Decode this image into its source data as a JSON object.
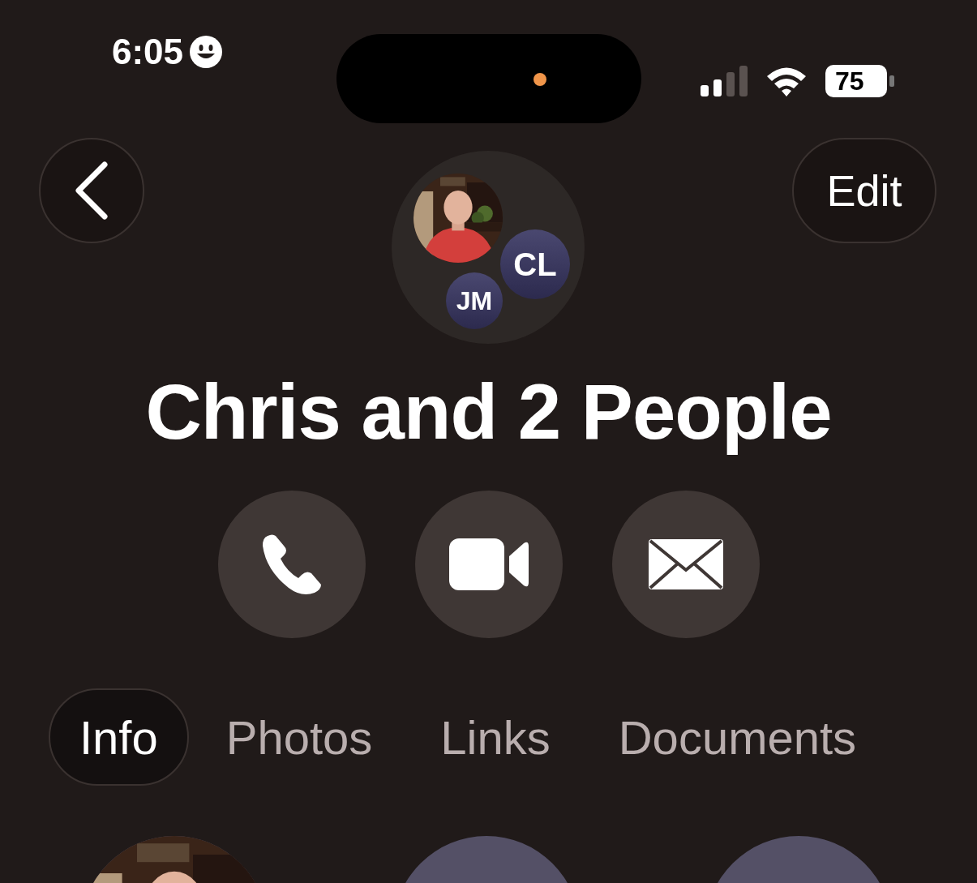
{
  "status_bar": {
    "time": "6:05",
    "battery": "75"
  },
  "nav": {
    "edit": "Edit"
  },
  "group": {
    "members": [
      {
        "kind": "picture"
      },
      {
        "kind": "initials",
        "initials": "CL"
      },
      {
        "kind": "initials",
        "initials": "JM"
      }
    ],
    "title": "Chris and 2 People"
  },
  "actions": [
    {
      "kind": "call"
    },
    {
      "kind": "video"
    },
    {
      "kind": "mail"
    }
  ],
  "tabs": [
    {
      "label": "Info",
      "selected": true
    },
    {
      "label": "Photos",
      "selected": false
    },
    {
      "label": "Links",
      "selected": false
    },
    {
      "label": "Documents",
      "selected": false
    }
  ],
  "people": [
    {
      "kind": "picture"
    },
    {
      "kind": "avatar"
    },
    {
      "kind": "avatar"
    }
  ]
}
